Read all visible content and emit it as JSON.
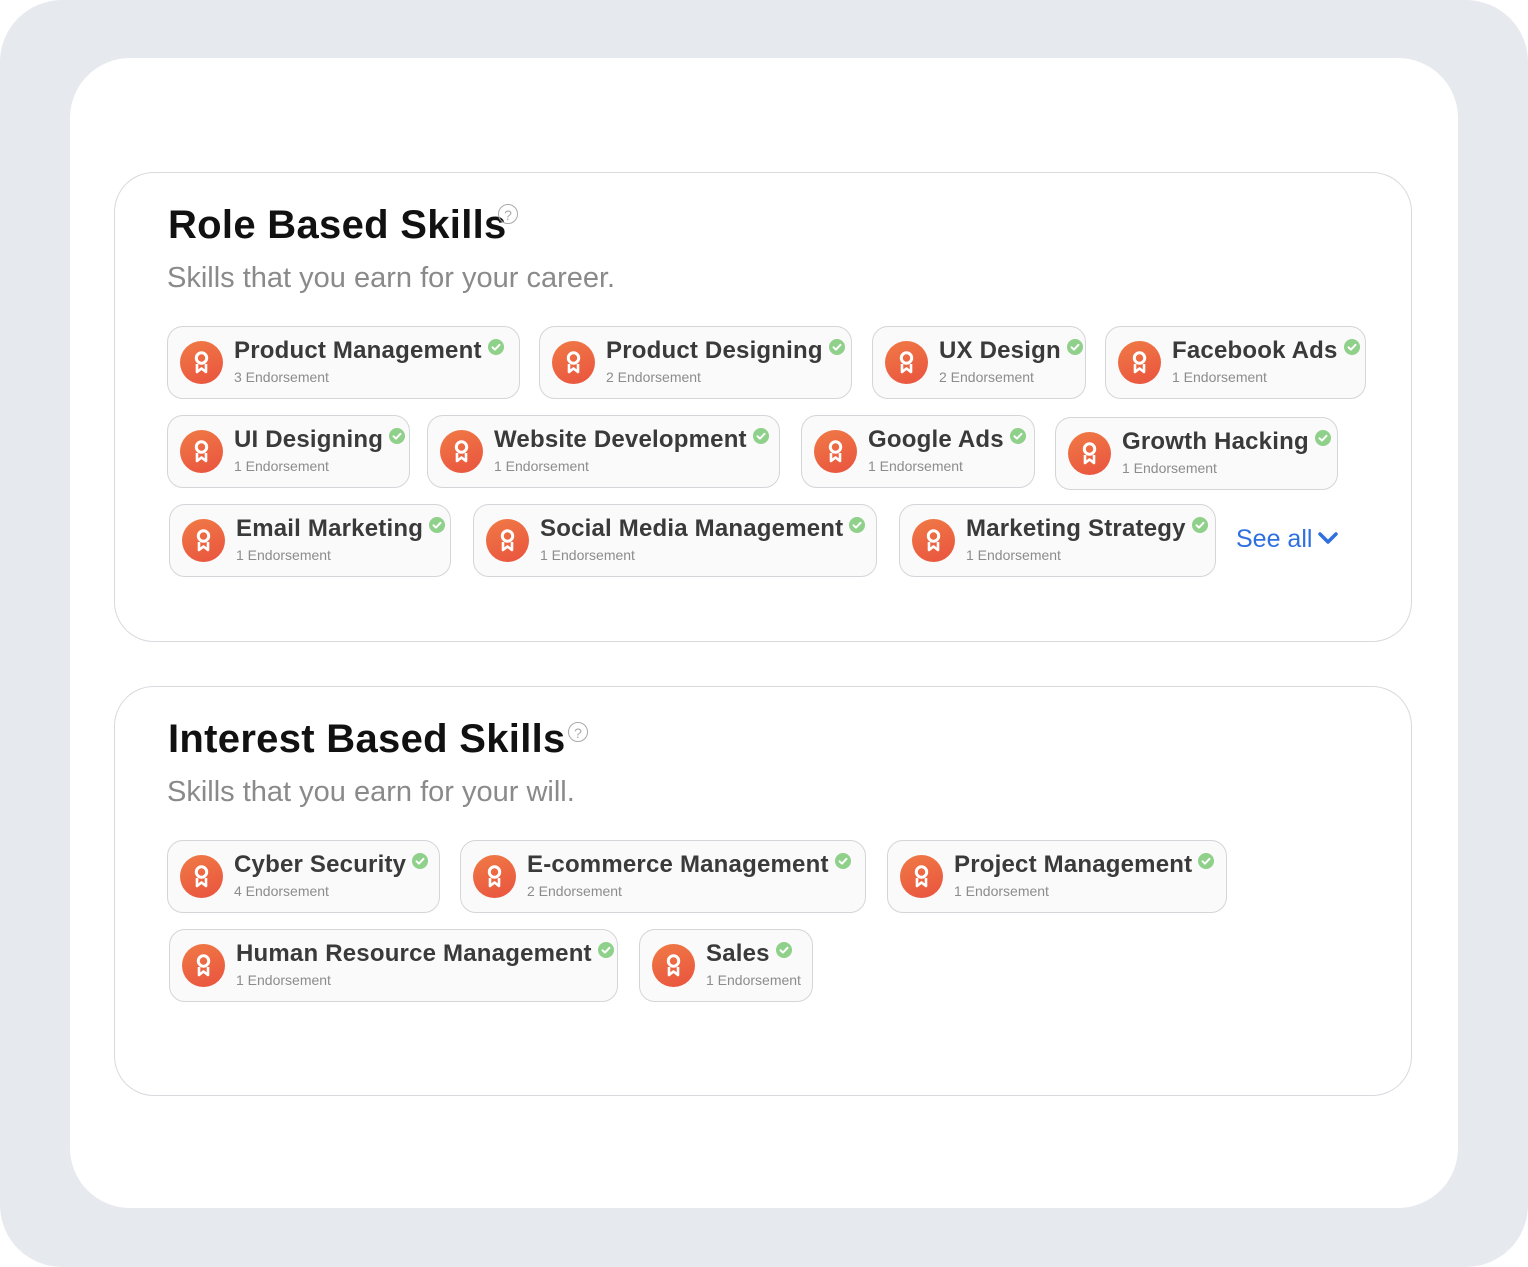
{
  "colors": {
    "accent_link": "#2f6fe0",
    "badge_gradient_start": "#f07a45",
    "badge_gradient_end": "#e9533f",
    "verified_green": "#8fd08a",
    "frame_bg": "#e6e9ee"
  },
  "role_section": {
    "title": "Role Based Skills",
    "help_icon": "?",
    "subtitle": "Skills that you earn for your career.",
    "see_all_label": "See all",
    "skills": [
      {
        "name": "Product Management",
        "endorsements": "3 Endorsement",
        "icon": "award-ribbon-icon",
        "verified": true
      },
      {
        "name": "Product Designing",
        "endorsements": "2 Endorsement",
        "icon": "award-ribbon-icon",
        "verified": true
      },
      {
        "name": "UX Design",
        "endorsements": "2 Endorsement",
        "icon": "award-ribbon-icon",
        "verified": true
      },
      {
        "name": "Facebook Ads",
        "endorsements": "1 Endorsement",
        "icon": "award-ribbon-icon",
        "verified": true
      },
      {
        "name": "UI Designing",
        "endorsements": "1 Endorsement",
        "icon": "award-ribbon-icon",
        "verified": true
      },
      {
        "name": "Website Development",
        "endorsements": "1 Endorsement",
        "icon": "award-ribbon-icon",
        "verified": true
      },
      {
        "name": "Google Ads",
        "endorsements": "1 Endorsement",
        "icon": "award-ribbon-icon",
        "verified": true
      },
      {
        "name": "Growth Hacking",
        "endorsements": "1 Endorsement",
        "icon": "award-ribbon-icon",
        "verified": true
      },
      {
        "name": "Email Marketing",
        "endorsements": "1 Endorsement",
        "icon": "award-ribbon-icon",
        "verified": true
      },
      {
        "name": "Social Media Management",
        "endorsements": "1 Endorsement",
        "icon": "award-ribbon-icon",
        "verified": true
      },
      {
        "name": "Marketing Strategy",
        "endorsements": "1 Endorsement",
        "icon": "award-ribbon-icon",
        "verified": true
      }
    ]
  },
  "interest_section": {
    "title": "Interest Based Skills",
    "help_icon": "?",
    "subtitle": "Skills that you earn for your will.",
    "skills": [
      {
        "name": "Cyber Security",
        "endorsements": "4 Endorsement",
        "icon": "award-ribbon-icon",
        "verified": true
      },
      {
        "name": "E-commerce Management",
        "endorsements": "2 Endorsement",
        "icon": "award-ribbon-icon",
        "verified": true
      },
      {
        "name": "Project Management",
        "endorsements": "1 Endorsement",
        "icon": "award-ribbon-icon",
        "verified": true
      },
      {
        "name": "Human Resource Management",
        "endorsements": "1 Endorsement",
        "icon": "award-ribbon-icon",
        "verified": true
      },
      {
        "name": "Sales",
        "endorsements": "1 Endorsement",
        "icon": "award-ribbon-icon",
        "verified": true
      }
    ]
  }
}
